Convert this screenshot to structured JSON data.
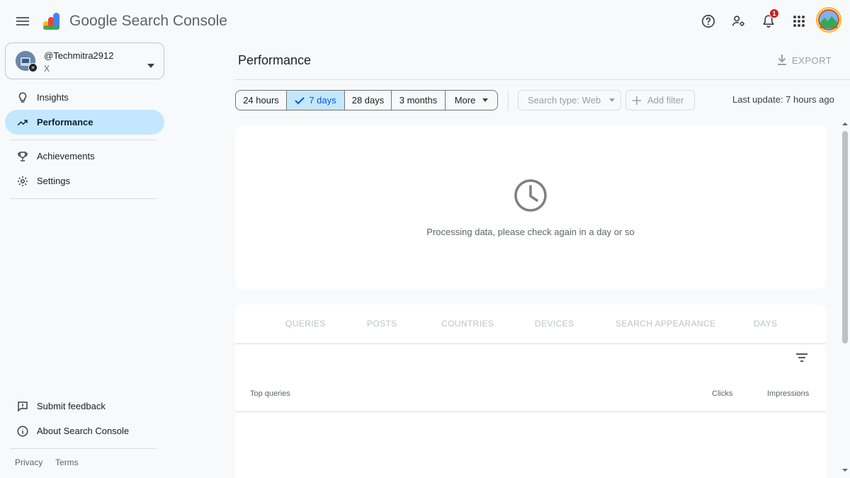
{
  "app": {
    "product_prefix": "Google",
    "product_name": "Search Console",
    "notification_count": "1"
  },
  "property": {
    "name": "@Techmitra2912",
    "sub": "X"
  },
  "sidebar": {
    "items": [
      {
        "label": "Insights",
        "icon": "lightbulb-icon"
      },
      {
        "label": "Performance",
        "icon": "trending-up-icon",
        "active": true
      },
      {
        "label": "Achievements",
        "icon": "trophy-icon"
      },
      {
        "label": "Settings",
        "icon": "gear-icon"
      }
    ],
    "bottom_items": [
      {
        "label": "Submit feedback",
        "icon": "feedback-icon"
      },
      {
        "label": "About Search Console",
        "icon": "info-icon"
      }
    ],
    "footer": {
      "privacy": "Privacy",
      "terms": "Terms"
    }
  },
  "header": {
    "title": "Performance",
    "export_label": "EXPORT"
  },
  "filters": {
    "ranges": [
      {
        "label": "24 hours"
      },
      {
        "label": "7 days",
        "selected": true
      },
      {
        "label": "28 days"
      },
      {
        "label": "3 months"
      },
      {
        "label": "More"
      }
    ],
    "search_type": "Search type: Web",
    "add_filter": "Add filter",
    "last_update": "Last update: 7 hours ago"
  },
  "processing": {
    "message": "Processing data, please check again in a day or so"
  },
  "report": {
    "tabs": [
      "QUERIES",
      "POSTS",
      "COUNTRIES",
      "DEVICES",
      "SEARCH APPEARANCE",
      "DAYS"
    ],
    "columns": {
      "main": "Top queries",
      "clicks": "Clicks",
      "impressions": "Impressions"
    }
  },
  "colors": {
    "accent": "#0b57d0",
    "selected_bg": "#c2e7ff",
    "badge": "#c5221f"
  }
}
